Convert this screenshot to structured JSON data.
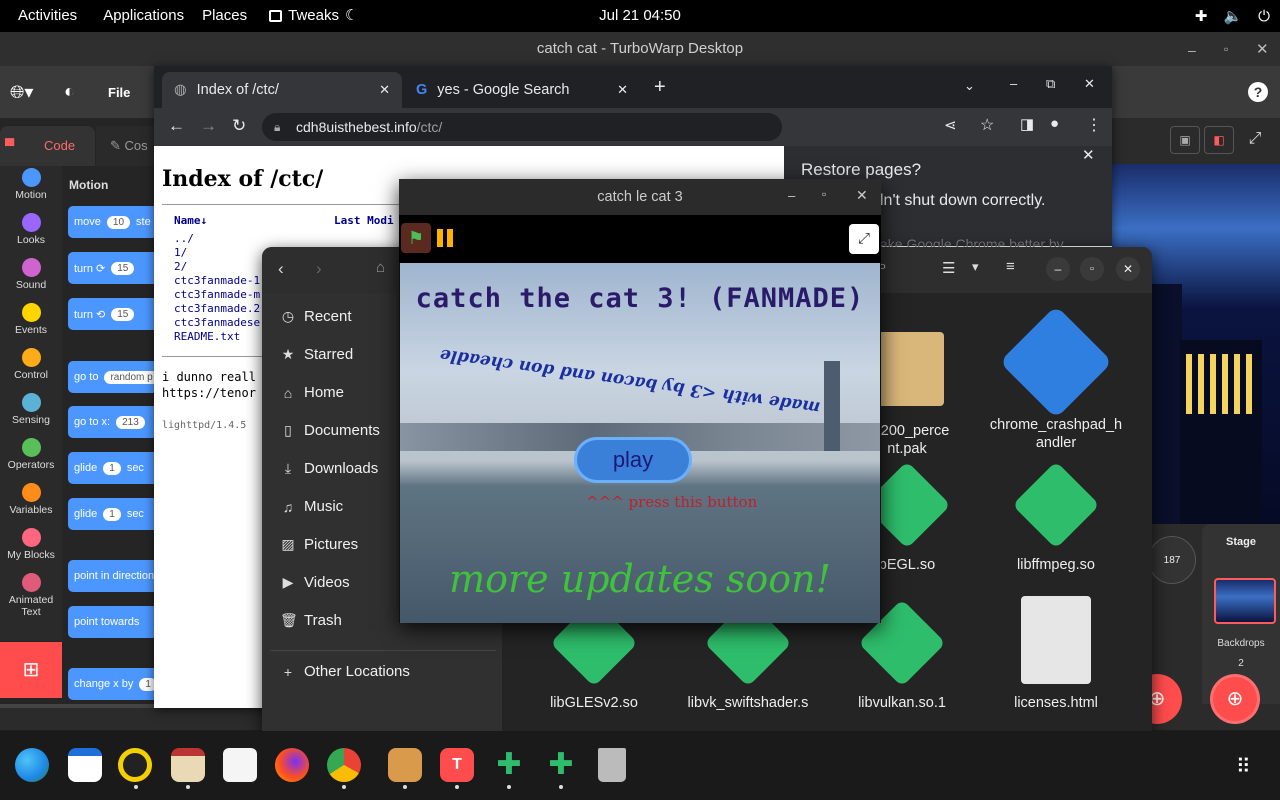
{
  "topbar": {
    "activities": "Activities",
    "applications": "Applications",
    "places": "Places",
    "tweaks": "Tweaks",
    "clock": "Jul 21  04:50"
  },
  "turbowarp": {
    "title": "catch cat - TurboWarp Desktop",
    "file_menu": "File",
    "tab_code": "Code",
    "tab_costumes": "Cos",
    "categories": [
      "Motion",
      "Looks",
      "Sound",
      "Events",
      "Control",
      "Sensing",
      "Operators",
      "Variables",
      "My Blocks",
      "Animated Text"
    ],
    "category_colors": [
      "#4c97ff",
      "#9966ff",
      "#cf63cf",
      "#ffd500",
      "#ffab19",
      "#5cb1d6",
      "#59c059",
      "#ff8c1a",
      "#ff6680",
      "#e05a7a"
    ],
    "palette_header": "Motion",
    "blocks": [
      {
        "text": "move",
        "value": "10",
        "suffix": "ste"
      },
      {
        "text": "turn ⟳",
        "value": "15",
        "suffix": ""
      },
      {
        "text": "turn ⟲",
        "value": "15",
        "suffix": ""
      },
      {
        "text": "go to",
        "value": "random p",
        "suffix": ""
      },
      {
        "text": "go to x:",
        "value": "213",
        "suffix": ""
      },
      {
        "text": "glide",
        "value": "1",
        "suffix": "sec"
      },
      {
        "text": "glide",
        "value": "1",
        "suffix": "sec"
      },
      {
        "text": "point in direction",
        "value": "",
        "suffix": ""
      },
      {
        "text": "point towards",
        "value": "",
        "suffix": ""
      },
      {
        "text": "change x by",
        "value": "1",
        "suffix": ""
      }
    ],
    "stage_label": "Stage",
    "backdrops_label": "Backdrops",
    "backdrops_count": "2",
    "value_187": "187"
  },
  "chrome": {
    "tab1": "Index of /ctc/",
    "tab2": "yes - Google Search",
    "url_host": "cdh8uisthebest.info",
    "url_path": "/ctc/",
    "page_heading": "Index of /ctc/",
    "col_name": "Name↓",
    "col_modified": "Last Modi",
    "files": [
      "../",
      "1/",
      "2/",
      "ctc3fanmade-1",
      "ctc3fanmade-m",
      "ctc3fanmade.2",
      "ctc3fanmadese",
      "README.txt"
    ],
    "text1": "i dunno reall",
    "text2": "https://tenor",
    "footer": "lighttpd/1.4.5",
    "restore_title": "Restore pages?",
    "restore_body": "ln't shut down correctly.",
    "restore_faded": "ake Google Chrome better by"
  },
  "game": {
    "title": "catch le cat 3",
    "heading": "catch the cat 3! (FANMADE)",
    "credits": "made with <3 by bacon and don cheadle",
    "play_button": "play",
    "press_hint": "^^^ press this button",
    "updates": "more updates soon!"
  },
  "nautilus": {
    "sidebar": [
      {
        "icon": "clock",
        "label": "Recent"
      },
      {
        "icon": "star",
        "label": "Starred"
      },
      {
        "icon": "home",
        "label": "Home"
      },
      {
        "icon": "document",
        "label": "Documents"
      },
      {
        "icon": "download",
        "label": "Downloads"
      },
      {
        "icon": "music",
        "label": "Music"
      },
      {
        "icon": "picture",
        "label": "Pictures"
      },
      {
        "icon": "video",
        "label": "Videos"
      },
      {
        "icon": "trash",
        "label": "Trash"
      }
    ],
    "other_locations": "Other Locations",
    "files": [
      "e_200_perce\nnt.pak",
      "chrome_crashpad_h\nandler",
      "bEGL.so",
      "libffmpeg.so",
      "libGLESv2.so",
      "libvk_swiftshader.s",
      "libvulkan.so.1",
      "licenses.html"
    ]
  }
}
